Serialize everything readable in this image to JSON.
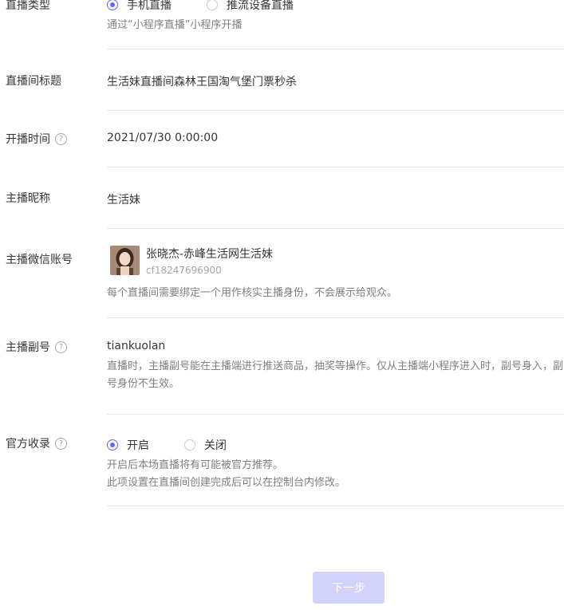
{
  "live_type": {
    "label": "直播类型",
    "options": [
      "手机直播",
      "推流设备直播"
    ],
    "selected": "手机直播",
    "tip": "通过“小程序直播”小程序开播"
  },
  "room_title": {
    "label": "直播间标题",
    "value": "生活妹直播间森林王国淘气堡门票秒杀"
  },
  "start_time": {
    "label": "开播时间",
    "help_icon": "question-circle-icon",
    "value": "2021/07/30 0:00:00"
  },
  "anchor_nickname": {
    "label": "主播昵称",
    "value": "生活妹"
  },
  "anchor_wechat": {
    "label": "主播微信账号",
    "name": "张晓杰-赤峰生活网生活妹",
    "id": "cf18247696900",
    "tip": "每个直播间需要绑定一个用作核实主播身份，不会展示给观众。"
  },
  "anchor_sub": {
    "label": "主播副号",
    "help_icon": "question-circle-icon",
    "value": "tiankuolan",
    "tip": "直播时，主播副号能在主播端进行推送商品，抽奖等操作。仅从主播端小程序进入时，副号身入，副号身份不生效。"
  },
  "official_include": {
    "label": "官方收录",
    "help_icon": "question-circle-icon",
    "options": [
      "开启",
      "关闭"
    ],
    "selected": "开启",
    "tip_line1": "开启后本场直播将有可能被官方推荐。",
    "tip_line2": "此项设置在直播间创建完成后可以在控制台内修改。"
  },
  "next_button": {
    "label": "下一步"
  },
  "colors": {
    "accent": "#6467f0",
    "button_disabled": "#d3d2fb",
    "divider": "#e7e7eb",
    "tip_text": "#7f7f7f"
  }
}
